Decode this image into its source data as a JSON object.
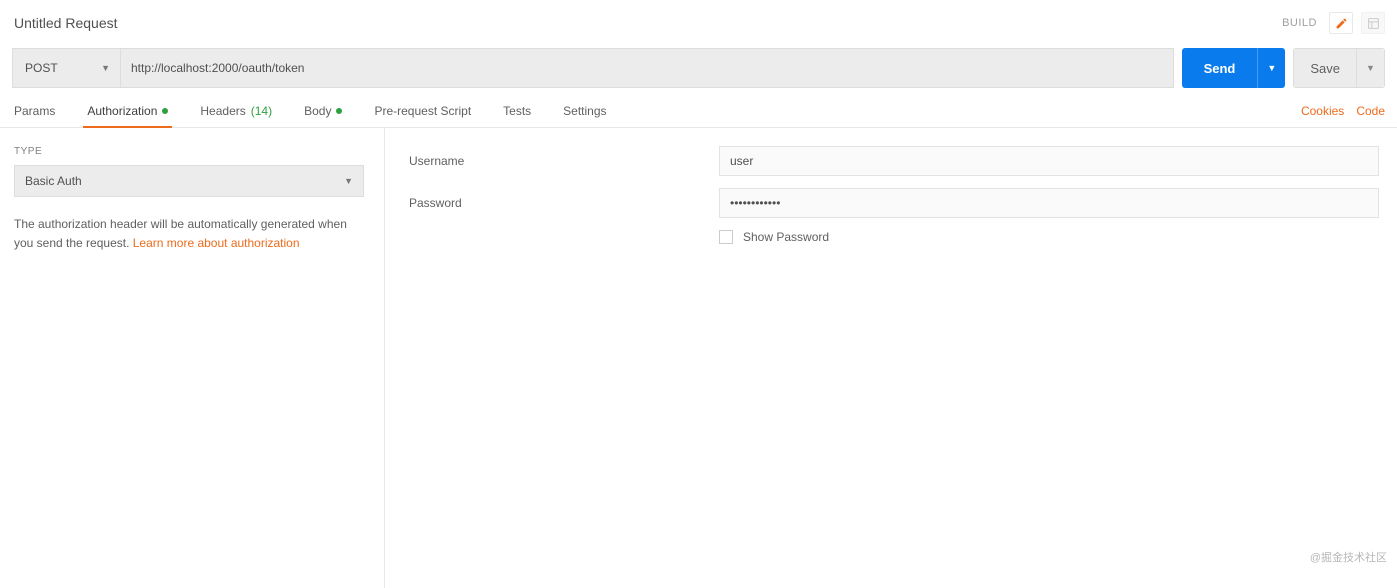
{
  "header": {
    "title": "Untitled Request",
    "build_label": "BUILD"
  },
  "request": {
    "method": "POST",
    "url": "http://localhost:2000/oauth/token",
    "send_label": "Send",
    "save_label": "Save"
  },
  "tabs": {
    "params": "Params",
    "authorization": "Authorization",
    "headers": "Headers",
    "headers_count": "(14)",
    "body": "Body",
    "prerequest": "Pre-request Script",
    "tests": "Tests",
    "settings": "Settings"
  },
  "right_links": {
    "cookies": "Cookies",
    "code": "Code"
  },
  "auth_panel": {
    "type_label": "TYPE",
    "type_value": "Basic Auth",
    "help_text": "The authorization header will be automatically generated when you send the request. ",
    "help_link": "Learn more about authorization"
  },
  "form": {
    "username_label": "Username",
    "username_value": "user",
    "password_label": "Password",
    "password_value": "••••••••••••",
    "show_password_label": "Show Password"
  },
  "watermark": "@掘金技术社区"
}
